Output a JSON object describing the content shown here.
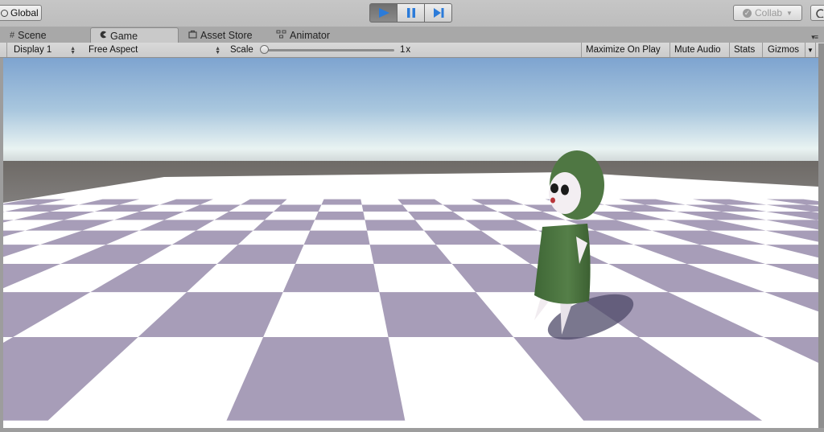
{
  "toolbar": {
    "global_label": "Global",
    "play_icons": [
      "play-icon",
      "pause-icon",
      "step-icon"
    ],
    "play_active_color": "#2b7bd9",
    "collab_label": "Collab"
  },
  "tabs": [
    {
      "label": "Scene",
      "icon": "grid-icon"
    },
    {
      "label": "Game",
      "icon": "pacman-icon",
      "active": true
    },
    {
      "label": "Asset Store",
      "icon": "bag-icon"
    },
    {
      "label": "Animator",
      "icon": "nodes-icon"
    }
  ],
  "gamebar": {
    "display": "Display 1",
    "aspect": "Free Aspect",
    "scale_label": "Scale",
    "scale_value": "1x",
    "maximize": "Maximize On Play",
    "mute": "Mute Audio",
    "stats": "Stats",
    "gizmos": "Gizmos"
  },
  "scene": {
    "sky_top": "#7ea4d0",
    "sky_horizon": "#eef6f6",
    "ground_far": "#747474",
    "tile_light": "#ffffff",
    "tile_dark": "#a79db8",
    "character_body": "#4c7440",
    "character_face": "#f3eef2"
  }
}
